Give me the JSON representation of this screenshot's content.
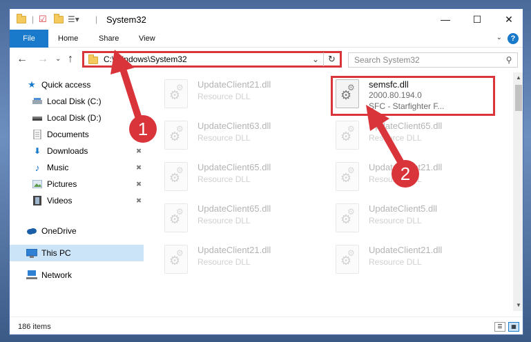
{
  "window": {
    "title": "System32",
    "controls": {
      "minimize": "—",
      "maximize": "☐",
      "close": "✕"
    }
  },
  "ribbon": {
    "tabs": [
      "File",
      "Home",
      "Share",
      "View"
    ],
    "help": "?"
  },
  "nav": {
    "address": "C:\\Windows\\System32",
    "search_placeholder": "Search System32"
  },
  "sidebar": {
    "items": [
      {
        "label": "Quick access",
        "icon": "star-icon",
        "pinned": false
      },
      {
        "label": "Local Disk (C:)",
        "icon": "drive-icon",
        "pinned": false
      },
      {
        "label": "Local Disk (D:)",
        "icon": "drive-icon",
        "pinned": false
      },
      {
        "label": "Documents",
        "icon": "documents-icon",
        "pinned": false
      },
      {
        "label": "Downloads",
        "icon": "download-icon",
        "pinned": true
      },
      {
        "label": "Music",
        "icon": "music-icon",
        "pinned": true
      },
      {
        "label": "Pictures",
        "icon": "pictures-icon",
        "pinned": true
      },
      {
        "label": "Videos",
        "icon": "videos-icon",
        "pinned": true
      },
      {
        "label": "OneDrive",
        "icon": "cloud-icon",
        "pinned": false
      },
      {
        "label": "This PC",
        "icon": "computer-icon",
        "pinned": false,
        "selected": true
      },
      {
        "label": "Network",
        "icon": "network-icon",
        "pinned": false
      }
    ]
  },
  "files": [
    {
      "name": "UpdateClient21.dll",
      "line2": "Resource DLL",
      "line3": "",
      "ghost": true
    },
    {
      "name": "semsfc.dll",
      "line2": "2000.80.194.0",
      "line3": "SFC - Starfighter F...",
      "ghost": false
    },
    {
      "name": "UpdateClient63.dll",
      "line2": "Resource DLL",
      "line3": "",
      "ghost": true
    },
    {
      "name": "UpdateClient65.dll",
      "line2": "Resource DLL",
      "line3": "",
      "ghost": true
    },
    {
      "name": "UpdateClient65.dll",
      "line2": "Resource DLL",
      "line3": "",
      "ghost": true
    },
    {
      "name": "UpdateClient21.dll",
      "line2": "Resource DLL",
      "line3": "",
      "ghost": true
    },
    {
      "name": "UpdateClient65.dll",
      "line2": "Resource DLL",
      "line3": "",
      "ghost": true
    },
    {
      "name": "UpdateClient5.dll",
      "line2": "Resource DLL",
      "line3": "",
      "ghost": true
    },
    {
      "name": "UpdateClient21.dll",
      "line2": "Resource DLL",
      "line3": "",
      "ghost": true
    },
    {
      "name": "UpdateClient21.dll",
      "line2": "Resource DLL",
      "line3": "",
      "ghost": true
    }
  ],
  "status": {
    "item_count": "186 items"
  },
  "annotations": {
    "step1": "1",
    "step2": "2",
    "color": "#d9343a"
  }
}
